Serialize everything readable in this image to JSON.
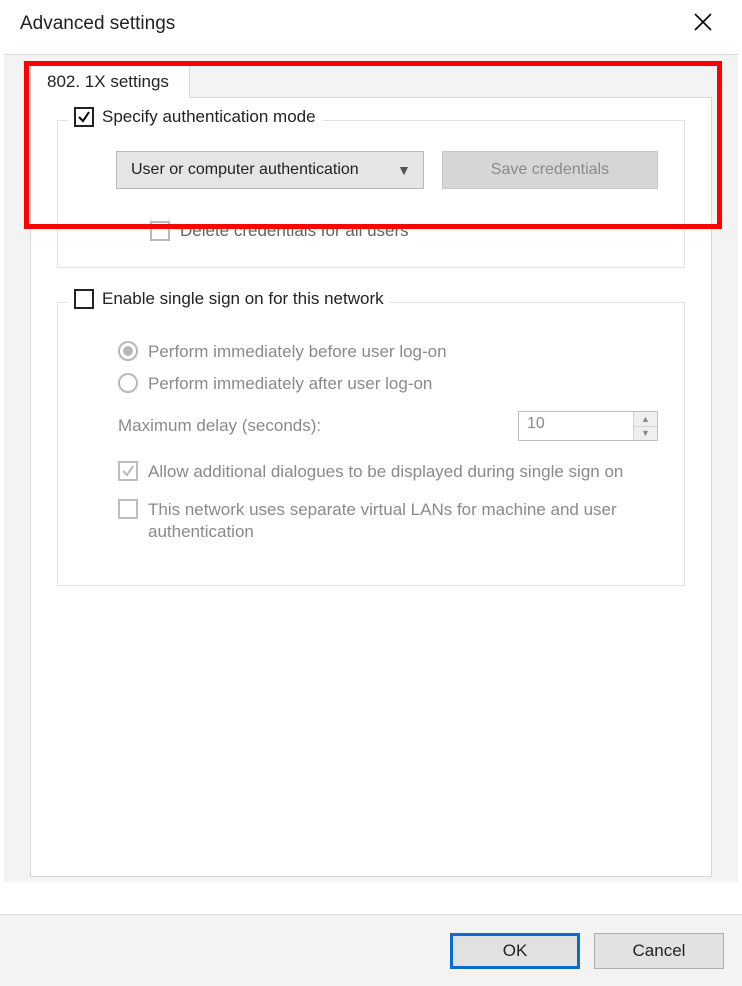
{
  "title": "Advanced settings",
  "tab_label": "802. 1X settings",
  "auth_group": {
    "legend": "Specify authentication mode",
    "checked": true,
    "mode_selected": "User or computer authentication",
    "save_btn": "Save credentials",
    "delete_label": "Delete credentials for all users"
  },
  "sso_group": {
    "legend": "Enable single sign on for this network",
    "checked": false,
    "radio_before": "Perform immediately before user log-on",
    "radio_after": "Perform immediately after user log-on",
    "delay_label": "Maximum delay (seconds):",
    "delay_value": "10",
    "allow_dialogs": "Allow additional dialogues to be displayed during single sign on",
    "separate_vlan": "This network uses separate virtual LANs for machine and user authentication"
  },
  "footer": {
    "ok": "OK",
    "cancel": "Cancel"
  }
}
